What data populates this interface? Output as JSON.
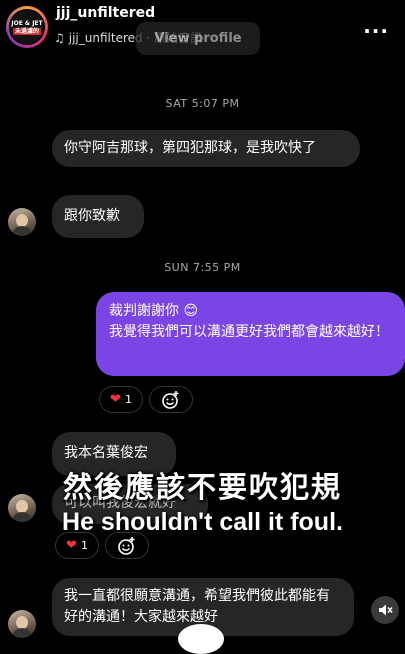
{
  "header": {
    "username": "jjj_unfiltered",
    "audio_label": "jjj_unfiltered · 原始音訊",
    "view_profile": "View profile",
    "avatar_line1": "JOE & JET",
    "avatar_line2": "未過濾的",
    "more_icon": "more-dots-icon"
  },
  "thread": {
    "ts1": "SAT 5:07 PM",
    "msg1": "你守阿吉那球，第四犯那球，是我吹快了",
    "msg2": "跟你致歉",
    "ts2": "SUN 7:55 PM",
    "out_line1": "裁判謝謝你",
    "out_emoji": "😊",
    "out_line2": "我覺得我們可以溝通更好我們都會越來越好！",
    "reaction1_count": "1",
    "msg3": "我本名葉俊宏",
    "msg4_partial": "可以叫我俊宏就好",
    "reaction2_count": "1",
    "msg5": "我一直都很願意溝通，希望我們彼此都能有好的溝通！大家越來越好"
  },
  "captions": {
    "chinese": "然後應該不要吹犯規",
    "english": "He shouldn't call it foul."
  },
  "colors": {
    "outgoing_bubble": "#7b45e6",
    "incoming_bubble": "#262626",
    "heart": "#ff3040"
  }
}
